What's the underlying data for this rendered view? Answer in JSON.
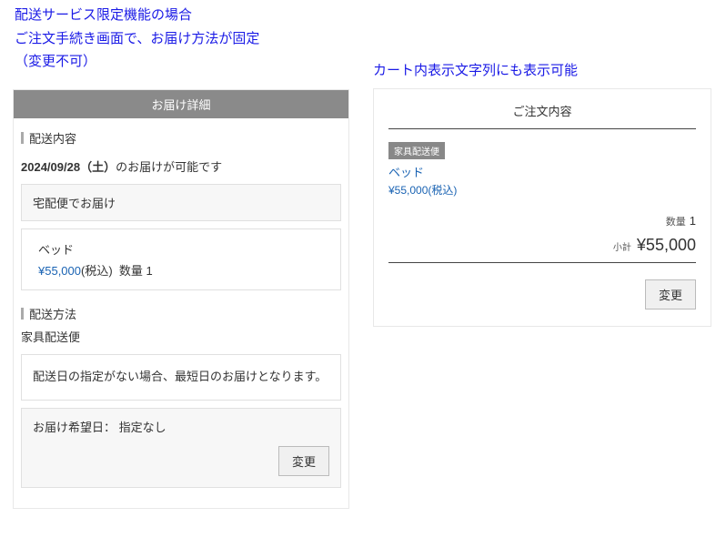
{
  "annotations": {
    "left_line1": "配送サービス限定機能の場合",
    "left_line2": "ご注文手続き画面で、お届け方法が固定",
    "left_line3": "（変更不可）",
    "right": "カート内表示文字列にも表示可能"
  },
  "left_panel": {
    "header": "お届け詳細",
    "section_delivery_content": "配送内容",
    "delivery_date_bold": "2024/09/28（土）",
    "delivery_date_suffix": "のお届けが可能です",
    "shipping_method_box": "宅配便でお届け",
    "product": {
      "name": "ベッド",
      "price": "¥55,000",
      "price_suffix": "(税込)",
      "qty_label": "数量",
      "qty_value": "1"
    },
    "section_delivery_method": "配送方法",
    "method_name": "家具配送便",
    "notice": "配送日の指定がない場合、最短日のお届けとなります。",
    "preferred_date_label": "お届け希望日：",
    "preferred_date_value": "指定なし",
    "change_button": "変更"
  },
  "right_panel": {
    "title": "ご注文内容",
    "badge": "家具配送便",
    "product_name": "ベッド",
    "product_price": "¥55,000(税込)",
    "qty_label": "数量",
    "qty_value": "1",
    "subtotal_label": "小計",
    "subtotal_value": "¥55,000",
    "change_button": "変更"
  }
}
